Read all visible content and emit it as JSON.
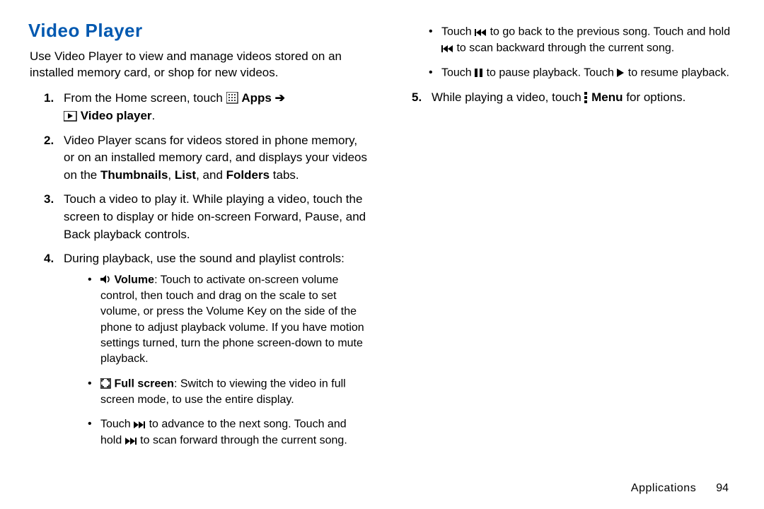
{
  "title": "Video Player",
  "intro": "Use Video Player to view and manage videos stored on an installed memory card, or shop for new videos.",
  "steps": {
    "s1a": "From the Home screen, touch ",
    "s1_apps": "Apps",
    "s1_arrow": " ➔",
    "s1_vp": "Video player",
    "s1_dot": ".",
    "s2a": "Video Player scans for videos stored in phone memory, or on an installed memory card, and displays your videos on the ",
    "s2_thumb": "Thumbnails",
    "s2_c1": ", ",
    "s2_list": "List",
    "s2_c2": ", and ",
    "s2_folders": "Folders",
    "s2_tail": " tabs.",
    "s3": "Touch a video to play it. While playing a video, touch the screen to display or hide on-screen Forward, Pause, and Back playback controls.",
    "s4": "During playback, use the sound and playlist controls:",
    "b_vol_label": "Volume",
    "b_vol": ": Touch to activate on-screen volume control, then touch and drag on the scale to set volume, or press the Volume Key on the side of the phone to adjust playback volume. If you have motion settings turned, turn the phone screen-down to mute playback.",
    "b_full_label": "Full screen",
    "b_full": ": Switch to viewing the video in full screen mode, to use the entire display.",
    "b_fwd_a": "Touch ",
    "b_fwd_b": " to advance to the next song. Touch and hold ",
    "b_fwd_c": " to scan forward through the current song.",
    "b_back_a": "Touch ",
    "b_back_b": " to go back to the previous song. Touch and hold ",
    "b_back_c": " to scan backward through the current song.",
    "b_pause_a": "Touch ",
    "b_pause_b": " to pause playback. Touch ",
    "b_pause_c": " to resume playback.",
    "s5a": "While playing a video, touch ",
    "s5_menu": "Menu",
    "s5b": " for options."
  },
  "nums": {
    "n1": "1.",
    "n2": "2.",
    "n3": "3.",
    "n4": "4.",
    "n5": "5."
  },
  "footer": {
    "section": "Applications",
    "page": "94"
  },
  "bullet": "•"
}
